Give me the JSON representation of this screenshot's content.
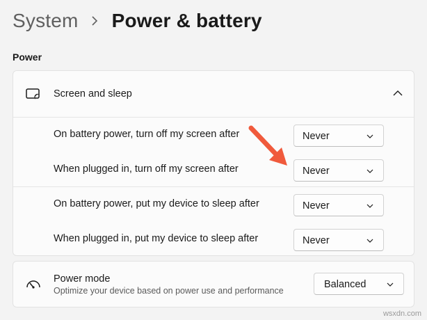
{
  "breadcrumb": {
    "parent": "System",
    "current": "Power & battery"
  },
  "section": {
    "label": "Power"
  },
  "screen_sleep": {
    "title": "Screen and sleep",
    "expanded": true,
    "rows": [
      {
        "label": "On battery power, turn off my screen after",
        "value": "Never"
      },
      {
        "label": "When plugged in, turn off my screen after",
        "value": "Never"
      },
      {
        "label": "On battery power, put my device to sleep after",
        "value": "Never"
      },
      {
        "label": "When plugged in, put my device to sleep after",
        "value": "Never"
      }
    ]
  },
  "power_mode": {
    "title": "Power mode",
    "description": "Optimize your device based on power use and performance",
    "value": "Balanced"
  },
  "annotation": {
    "arrow_color": "#f05a3c"
  },
  "watermark": "wsxdn.com",
  "icons": {
    "breadcrumb_separator": "chevron-right-icon",
    "screen_sleep": "screen-sleep-icon",
    "collapse": "chevron-up-icon",
    "dropdown": "chevron-down-icon",
    "power_mode": "speedometer-icon"
  }
}
